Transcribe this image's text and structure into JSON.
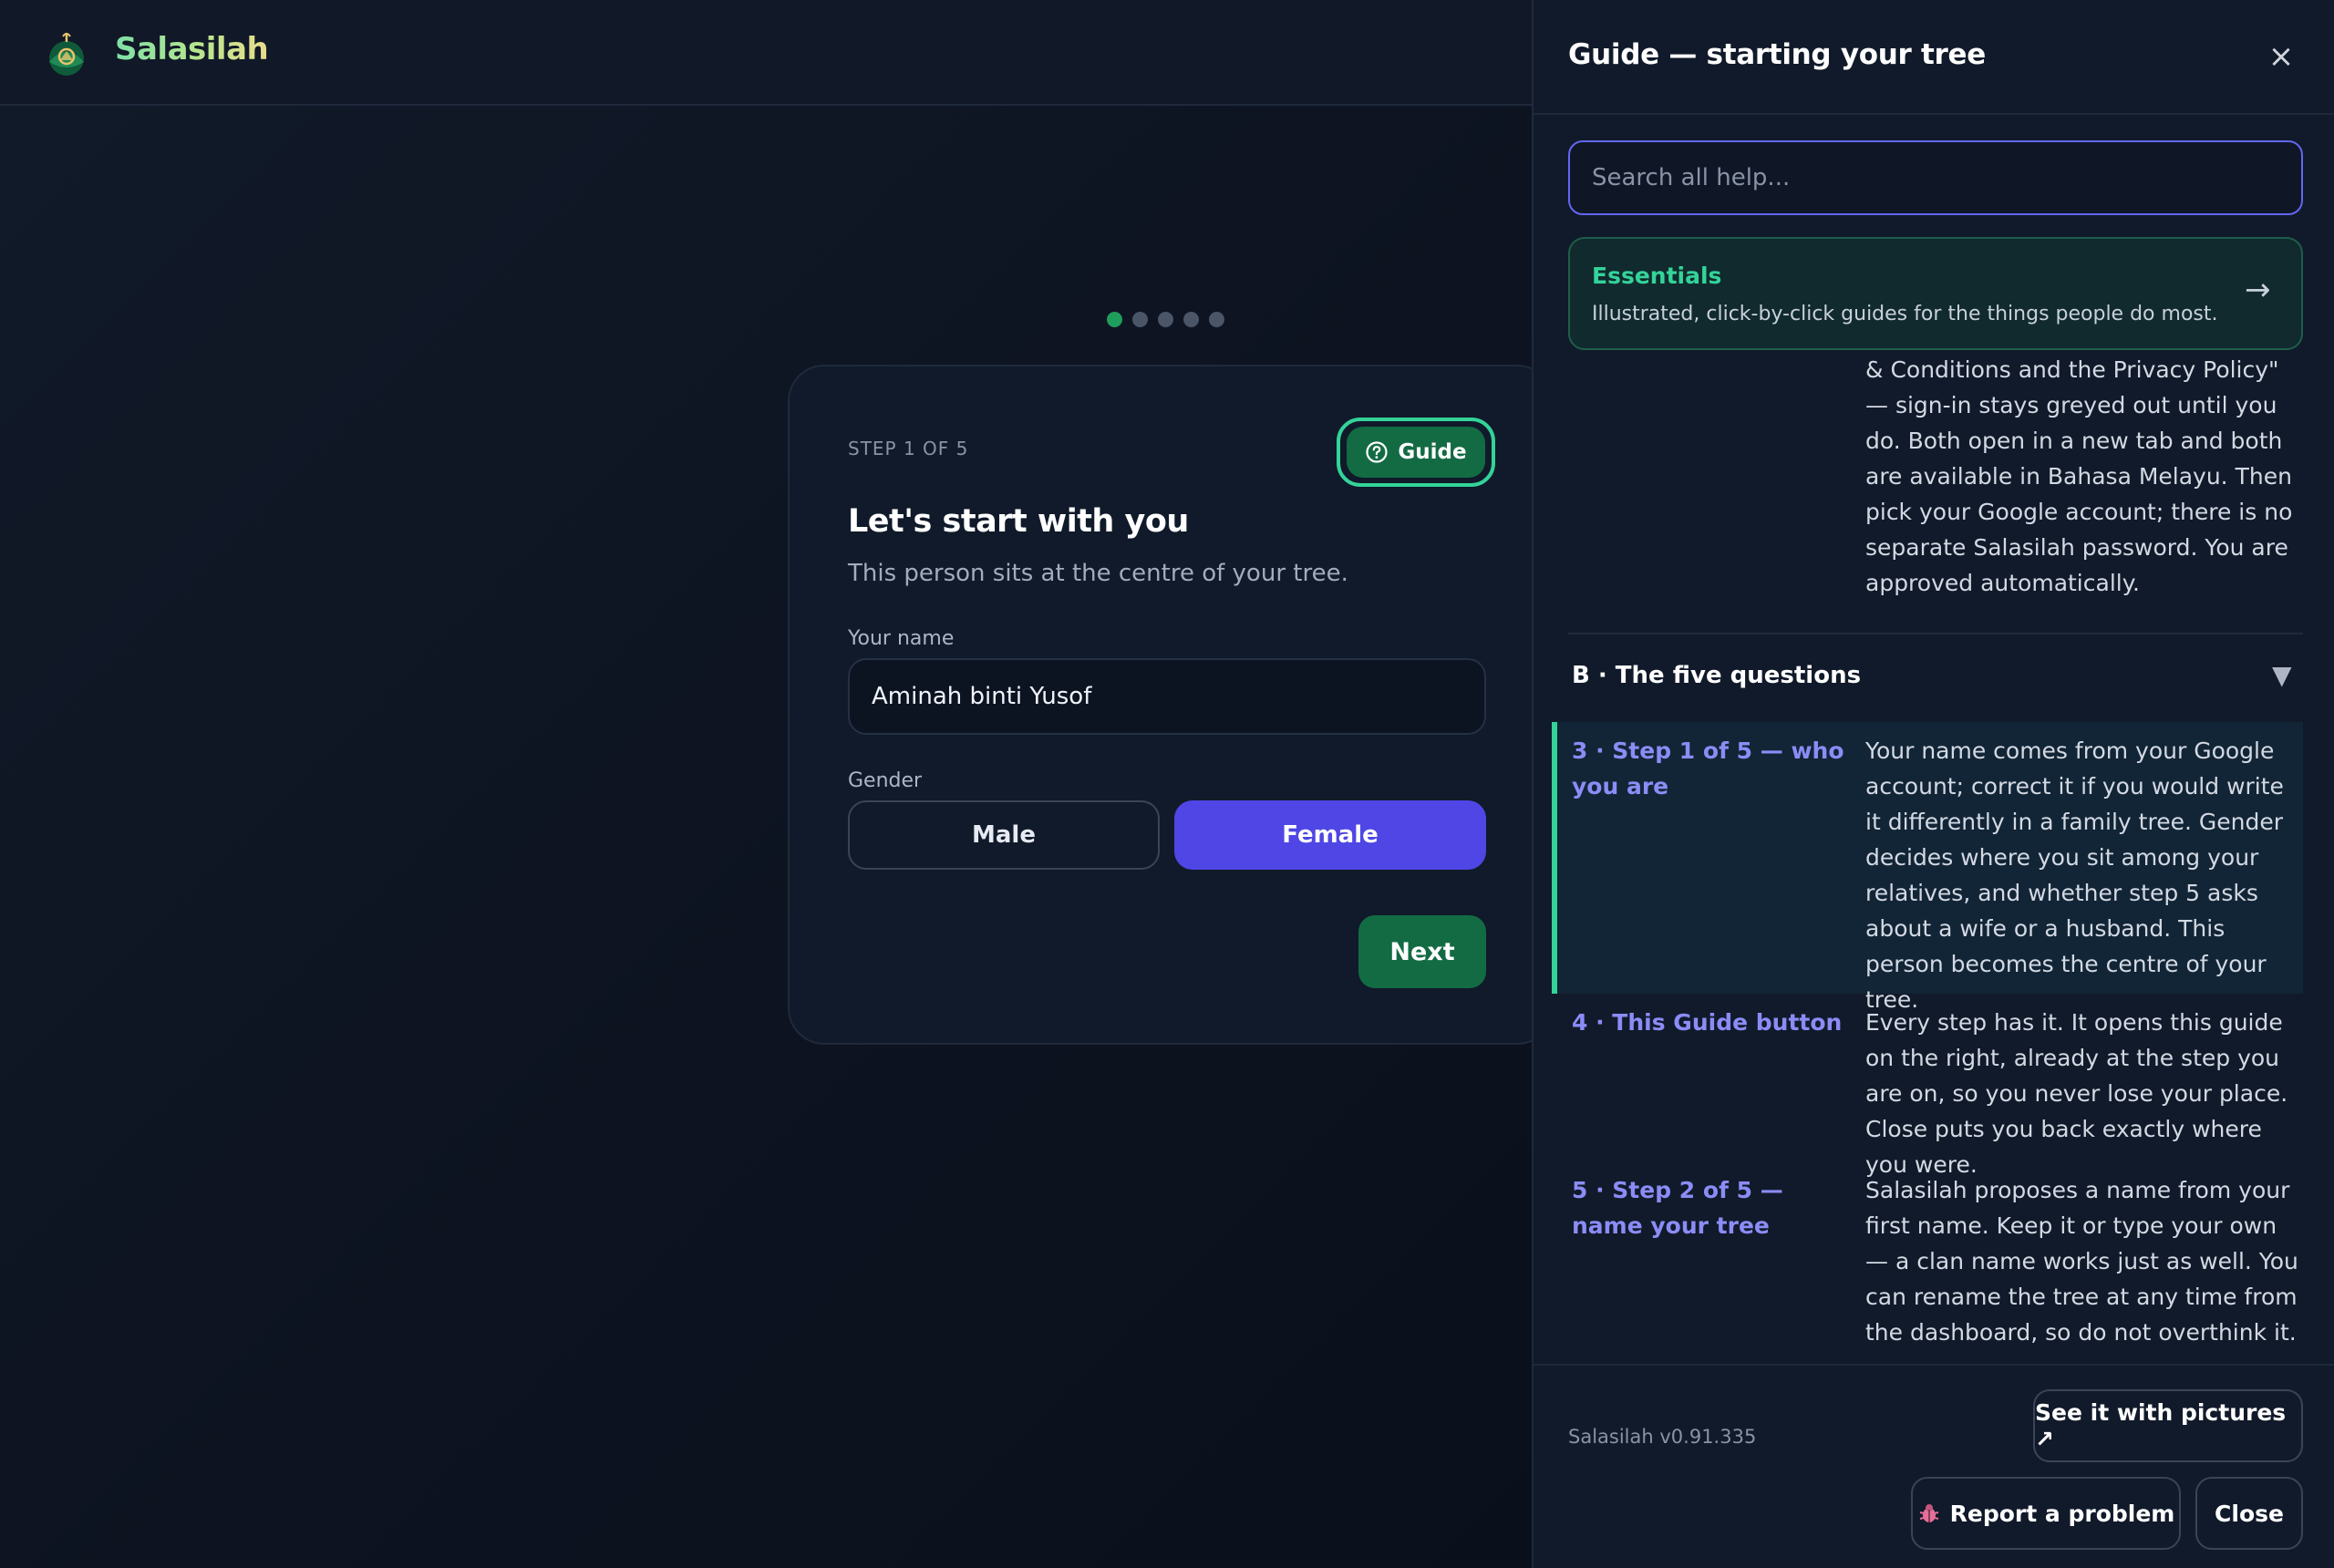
{
  "app": {
    "brand": "Salasilah"
  },
  "wizard": {
    "progress": {
      "total_steps": 5,
      "current_step": 1
    },
    "step_label": "STEP 1 OF 5",
    "guide_label": "Guide",
    "title": "Let's start with you",
    "subtitle": "This person sits at the centre of your tree.",
    "name_label": "Your name",
    "name_value": "Aminah binti Yusof",
    "gender_label": "Gender",
    "gender_options": [
      "Male",
      "Female"
    ],
    "gender_selected": "Female",
    "next_label": "Next"
  },
  "panel": {
    "title": "Guide — starting your tree",
    "close_icon": "×",
    "search_placeholder": "Search all help...",
    "essentials": {
      "title": "Essentials",
      "description": "Illustrated, click-by-click guides for the things people do most.",
      "arrow": "→"
    },
    "continued_text": "& Conditions and the Privacy Policy\" — sign-in stays greyed out until you do. Both open in a new tab and both are available in Bahasa Melayu. Then pick your Google account; there is no separate Salasilah password. You are approved automatically.",
    "section": {
      "title": "B · The five questions",
      "caret": "▼",
      "items": [
        {
          "question": "3 · Step 1 of 5 — who you are",
          "answer": "Your name comes from your Google account; correct it if you would write it differently in a family tree. Gender decides where you sit among your relatives, and whether step 5 asks about a wife or a husband. This person becomes the centre of your tree."
        },
        {
          "question": "4 · This Guide button",
          "answer": "Every step has it. It opens this guide on the right, already at the step you are on, so you never lose your place. Close puts you back exactly where you were."
        },
        {
          "question": "5 · Step 2 of 5 — name your tree",
          "answer": "Salasilah proposes a name from your first name. Keep it or type your own — a clan name works just as well. You can rename the tree at any time from the dashboard, so do not overthink it."
        }
      ]
    },
    "footer": {
      "version": "Salasilah v0.91.335",
      "pictures_label": "See it with pictures ↗",
      "report_label": "Report a problem",
      "close_label": "Close"
    }
  },
  "colors": {
    "accent_green": "#136b44",
    "accent_mint": "#34d399",
    "accent_indigo": "#4f46e5",
    "link_purple": "#8b8cf6"
  }
}
